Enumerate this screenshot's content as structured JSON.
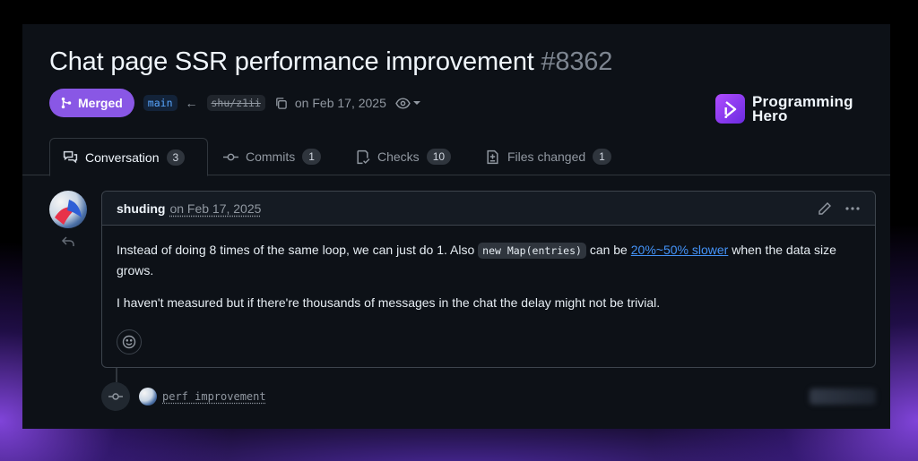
{
  "pr": {
    "title": "Chat page SSR performance improvement",
    "number": "#8362",
    "status": "Merged",
    "base_branch": "main",
    "head_branch": "shu/z1ii",
    "meta_date": "on Feb 17, 2025"
  },
  "brand": {
    "line1": "Programming",
    "line2": "Hero"
  },
  "tabs": [
    {
      "label": "Conversation",
      "count": "3",
      "icon": "comment-discussion-icon"
    },
    {
      "label": "Commits",
      "count": "1",
      "icon": "git-commit-icon"
    },
    {
      "label": "Checks",
      "count": "10",
      "icon": "checklist-icon"
    },
    {
      "label": "Files changed",
      "count": "1",
      "icon": "file-diff-icon"
    }
  ],
  "comment": {
    "author": "shuding",
    "date": "on Feb 17, 2025",
    "p1_before": "Instead of doing 8 times of the same loop, we can just do 1. Also",
    "p1_code": "new Map(entries)",
    "p1_middle": "can be",
    "p1_link": "20%~50% slower",
    "p1_after": "when the data size grows.",
    "p2": "I haven't measured but if there're thousands of messages in the chat the delay might not be trivial."
  },
  "commit": {
    "message": "perf improvement"
  },
  "colors": {
    "merged": "#8957e5",
    "link": "#4493f8",
    "background": "#0d1117",
    "glow": "#9650ff"
  }
}
